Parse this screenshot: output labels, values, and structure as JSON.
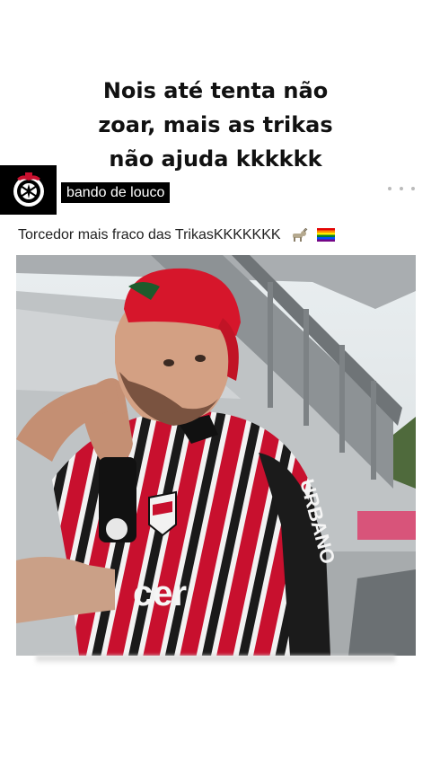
{
  "caption": {
    "line1": "Nois até tenta não",
    "line2": "zoar, mais as trikas",
    "line3": "não ajuda kkkkkk"
  },
  "post": {
    "username": "bando de louco",
    "text": "Torcedor mais fraco das TrikasKKKKKKK",
    "emojis": [
      "goat-emoji",
      "rainbow-flag-emoji"
    ],
    "avatar": "corinthians-crest"
  },
  "video": {
    "jersey_sponsor": "URBANO",
    "chest_text": "cer",
    "colors": {
      "jersey_red": "#c8102e",
      "cap_red": "#d6162b",
      "stadium_grey": "#b9bcbf"
    }
  }
}
